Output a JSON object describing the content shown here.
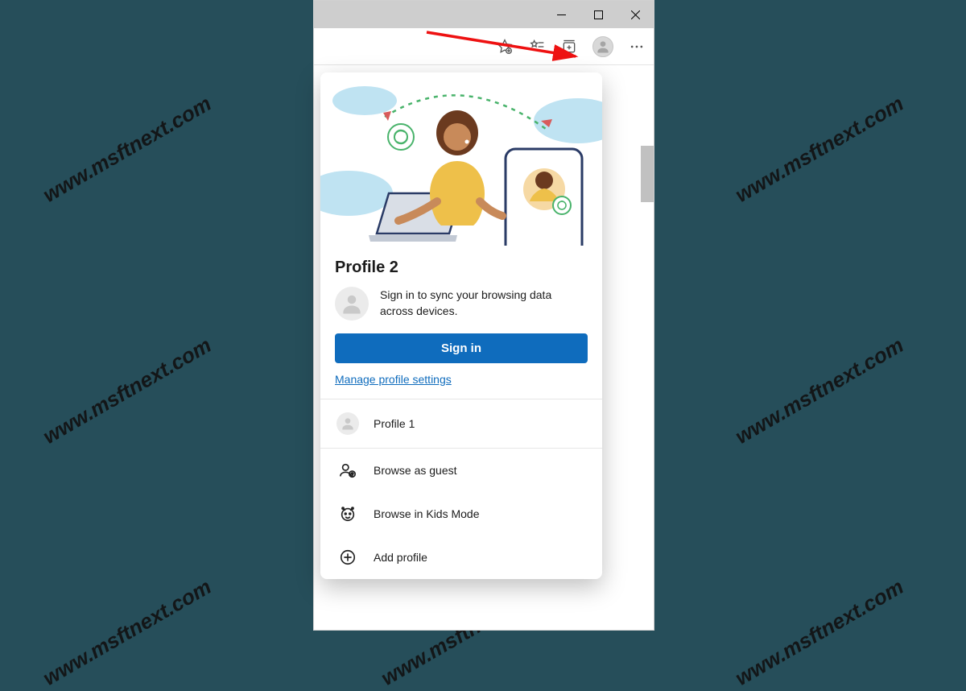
{
  "watermark": "www.msftnext.com",
  "popup": {
    "title": "Profile 2",
    "sync_text": "Sign in to sync your browsing data across devices.",
    "signin_label": "Sign in",
    "manage_link": "Manage profile settings",
    "other_profile": "Profile 1",
    "guest": "Browse as guest",
    "kids": "Browse in Kids Mode",
    "add": "Add profile"
  }
}
